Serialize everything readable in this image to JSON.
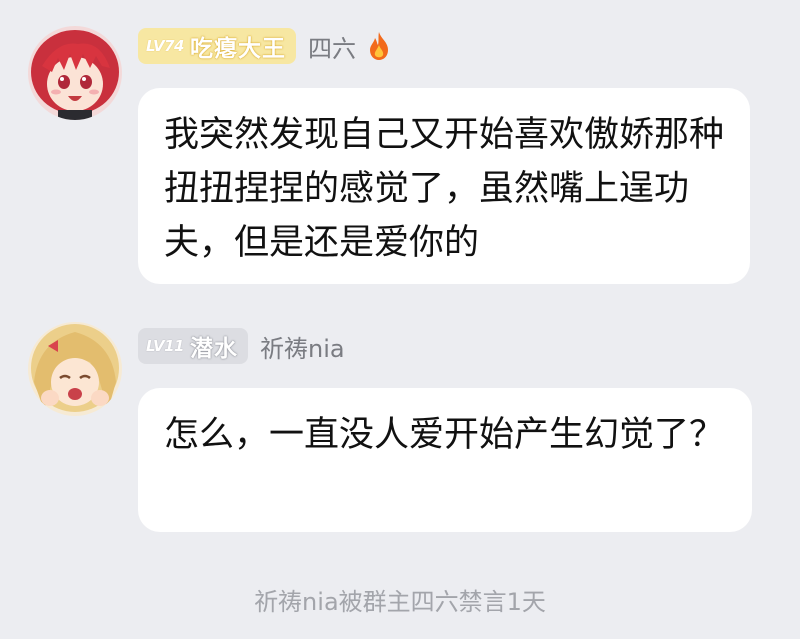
{
  "messages": [
    {
      "level": "LV74",
      "title": "吃瘪大王",
      "sender": "四六",
      "sender_icon": "fire-icon",
      "text": "我突然发现自己又开始喜欢傲娇那种扭扭捏捏的感觉了，虽然嘴上逞功夫，但是还是爱你的",
      "badge_color": "#f7e7a2"
    },
    {
      "level": "LV11",
      "title": "潜水",
      "sender": "祈祷nia",
      "text": "怎么，一直没人爱开始产生幻觉了？",
      "badge_color": "#dcdde2"
    }
  ],
  "system_notice": "祈祷nia被群主四六禁言1天",
  "colors": {
    "background": "#ecedf1",
    "bubble": "#ffffff",
    "name_text": "#7a7c82",
    "system_text": "#a3a5ab"
  }
}
